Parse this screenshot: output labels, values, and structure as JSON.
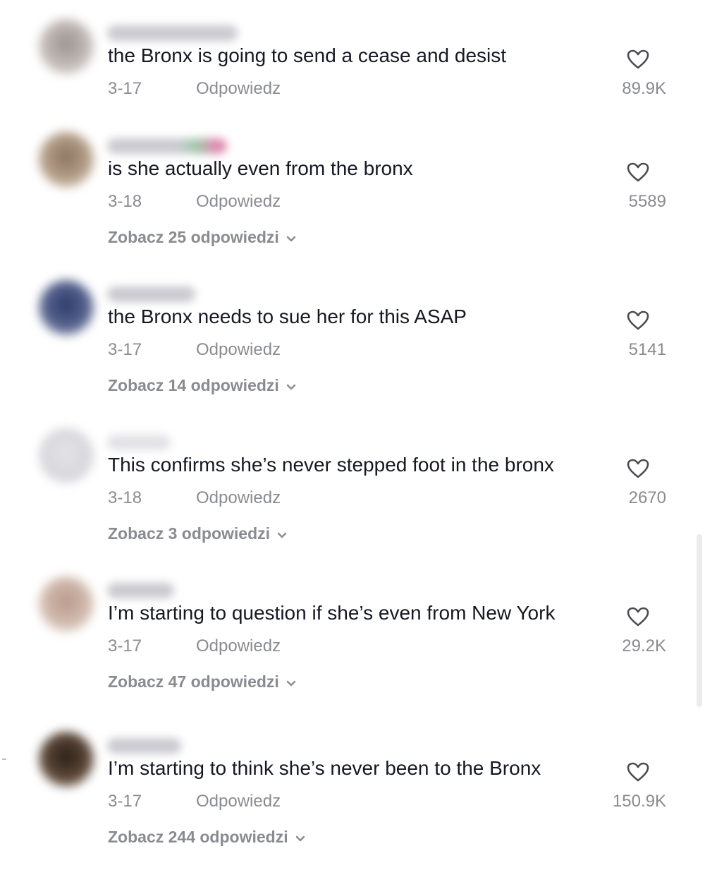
{
  "icons": {
    "like": "heart-outline-icon",
    "expand": "chevron-down-icon"
  },
  "colors": {
    "text_primary": "#161823",
    "text_secondary": "#8a8b91",
    "background": "#ffffff"
  },
  "comments": [
    {
      "text": "the Bronx is going to send a cease and desist",
      "date": "3-17",
      "reply_label": "Odpowiedz",
      "likes": "89.9K",
      "view_replies": ""
    },
    {
      "text": "is she actually even from the bronx",
      "date": "3-18",
      "reply_label": "Odpowiedz",
      "likes": "5589",
      "view_replies": "Zobacz 25 odpowiedzi"
    },
    {
      "text": "the Bronx needs to sue her for this ASAP",
      "date": "3-17",
      "reply_label": "Odpowiedz",
      "likes": "5141",
      "view_replies": "Zobacz 14 odpowiedzi"
    },
    {
      "text": "This confirms she’s never stepped foot in the bronx",
      "date": "3-18",
      "reply_label": "Odpowiedz",
      "likes": "2670",
      "view_replies": "Zobacz 3 odpowiedzi"
    },
    {
      "text": "I’m starting to question if she’s even from New York",
      "date": "3-17",
      "reply_label": "Odpowiedz",
      "likes": "29.2K",
      "view_replies": "Zobacz 47 odpowiedzi"
    },
    {
      "text": "I’m starting to think she’s never been to the Bronx",
      "date": "3-17",
      "reply_label": "Odpowiedz",
      "likes": "150.9K",
      "view_replies": "Zobacz 244 odpowiedzi"
    }
  ]
}
